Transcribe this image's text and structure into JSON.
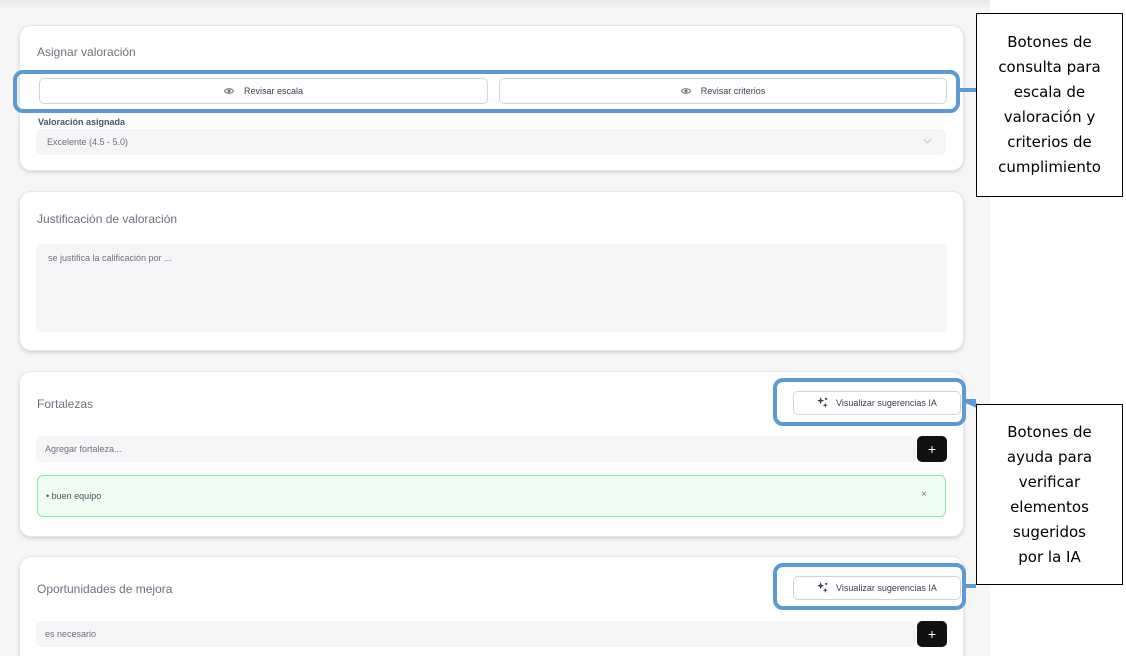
{
  "rating": {
    "title": "Asignar valoración",
    "review_scale_label": "Revisar escala",
    "review_criteria_label": "Revisar criterios",
    "assigned_label": "Valoración asignada",
    "assigned_value": "Excelente (4.5 - 5.0)"
  },
  "justification": {
    "title": "Justificación de valoración",
    "value": "se justifica la calificación por ..."
  },
  "strengths": {
    "title": "Fortalezas",
    "ai_button_label": "Visualizar sugerencias IA",
    "input_placeholder": "Agregar fortaleza...",
    "add_label": "+",
    "items": [
      {
        "text": "• buen equipo",
        "remove_label": "×"
      }
    ]
  },
  "improvements": {
    "title": "Oportunidades de mejora",
    "ai_button_label": "Visualizar sugerencias IA",
    "input_value": "es necesario",
    "add_label": "+"
  },
  "annotations": {
    "top": [
      "Botones de",
      "consulta para",
      "escala de",
      "valoración y",
      "criterios de",
      "cumplimiento"
    ],
    "bottom": [
      "Botones de",
      "ayuda para",
      "verificar",
      "elementos",
      "sugeridos",
      "por la IA"
    ]
  },
  "colors": {
    "highlight": "#5b9bd5",
    "add_button": "#111114",
    "item_background": "#f0fdf4",
    "item_border": "#86efac"
  },
  "icons": {
    "review_buttons": "eye-icon",
    "ai_buttons": "sparkles-icon",
    "select": "chevron-down-icon"
  }
}
